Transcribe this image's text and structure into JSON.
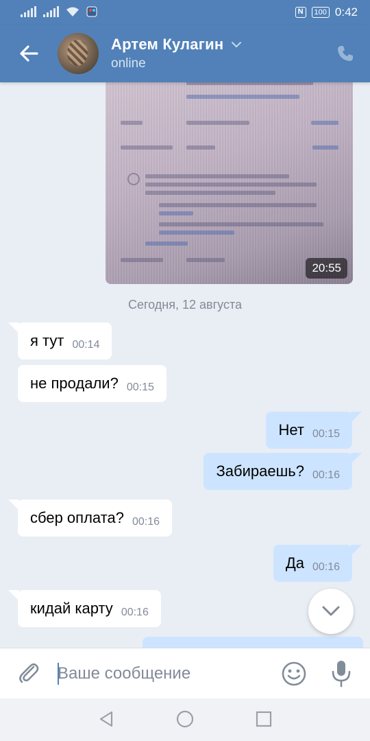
{
  "status_bar": {
    "time": "0:42",
    "battery": "100",
    "nfc": "N"
  },
  "header": {
    "name": "Артем Кулагин",
    "status": "online"
  },
  "photo": {
    "time": "20:55"
  },
  "date_separator": "Сегодня, 12 августа",
  "messages": [
    {
      "dir": "in",
      "text": "я тут",
      "time": "00:14"
    },
    {
      "dir": "in",
      "text": "не продали?",
      "time": "00:15"
    },
    {
      "dir": "out",
      "text": "Нет",
      "time": "00:15"
    },
    {
      "dir": "out",
      "text": "Забираешь?",
      "time": "00:16"
    },
    {
      "dir": "in",
      "text": "сбер оплата?",
      "time": "00:16"
    },
    {
      "dir": "out",
      "text": "Да",
      "time": "00:16"
    },
    {
      "dir": "in",
      "text": "кидай карту",
      "time": "00:16"
    }
  ],
  "composer": {
    "placeholder": "Ваше сообщение"
  },
  "colors": {
    "brand": "#5181b8",
    "outgoing_bubble": "#cce4ff",
    "background": "#e9eef4"
  },
  "icons": [
    "back-arrow-icon",
    "chevron-down-icon",
    "phone-icon",
    "paperclip-icon",
    "emoji-icon",
    "microphone-icon",
    "scroll-down-icon"
  ]
}
